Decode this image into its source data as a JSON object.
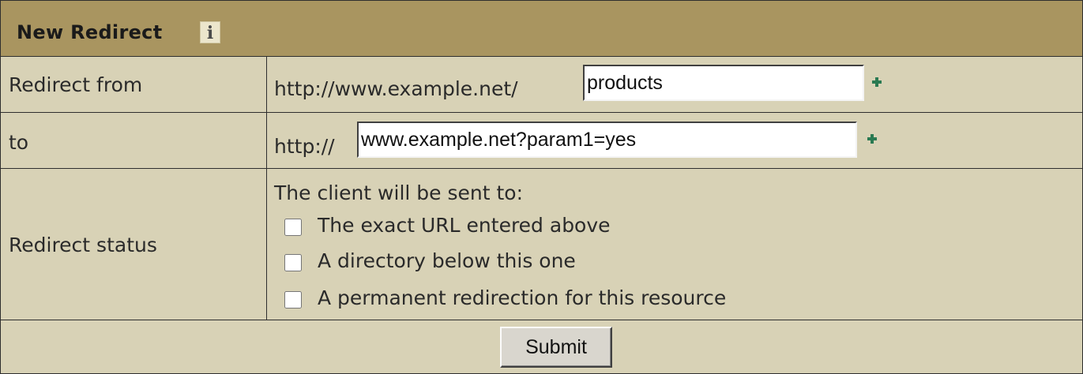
{
  "header": {
    "title": "New Redirect",
    "info_icon": "i"
  },
  "form": {
    "redirect_from": {
      "label": "Redirect from",
      "prefix": "http://www.example.net/",
      "value": "products"
    },
    "redirect_to": {
      "label": "to",
      "prefix": "http://",
      "value": "www.example.net?param1=yes"
    },
    "redirect_status": {
      "label": "Redirect status",
      "intro": "The client will be sent to:",
      "options": [
        {
          "label": "The exact URL entered above",
          "checked": false
        },
        {
          "label": "A directory below this one",
          "checked": false
        },
        {
          "label": "A permanent redirection for this resource",
          "checked": false
        }
      ]
    },
    "submit_label": "Submit"
  },
  "colors": {
    "header_bg": "#a99560",
    "body_bg": "#d8d2b6",
    "border": "#2e2e2e",
    "plus_icon": "#2a7a52"
  },
  "icons": {
    "info": "info-icon",
    "add": "plus-icon"
  }
}
